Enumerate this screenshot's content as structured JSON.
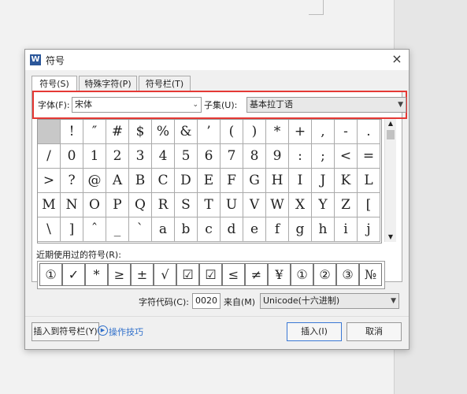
{
  "dialog": {
    "title": "符号",
    "app_icon": "W",
    "close": "×"
  },
  "tabs": [
    "符号(S)",
    "特殊字符(P)",
    "符号栏(T)"
  ],
  "font_row": {
    "font_label": "字体(F):",
    "font_value": "宋体",
    "subset_label": "子集(U):",
    "subset_value": "基本拉丁语"
  },
  "symbol_grid": [
    [
      " ",
      "!",
      "″",
      "#",
      "$",
      "%",
      "&",
      "’",
      "(",
      ")",
      "*",
      "+",
      ",",
      "-",
      ".",
      "/"
    ],
    [
      "/",
      "0",
      "1",
      "2",
      "3",
      "4",
      "5",
      "6",
      "7",
      "8",
      "9",
      ":",
      ";",
      "<",
      "="
    ],
    [
      ">",
      "?",
      "@",
      "A",
      "B",
      "C",
      "D",
      "E",
      "F",
      "G",
      "H",
      "I",
      "J",
      "K",
      "L"
    ],
    [
      "M",
      "N",
      "O",
      "P",
      "Q",
      "R",
      "S",
      "T",
      "U",
      "V",
      "W",
      "X",
      "Y",
      "Z",
      "["
    ],
    [
      "\\",
      "]",
      "ˆ",
      "_",
      "`",
      "a",
      "b",
      "c",
      "d",
      "e",
      "f",
      "g",
      "h",
      "i",
      "j"
    ]
  ],
  "recent": {
    "label": "近期使用过的符号(R):",
    "symbols": [
      "①",
      "✓",
      "*",
      "≥",
      "±",
      "√",
      "☑",
      "☑",
      "≤",
      "≠",
      "¥",
      "①",
      "②",
      "③",
      "№"
    ]
  },
  "code_row": {
    "code_label": "字符代码(C):",
    "code_value": "0020",
    "from_label": "来自(M)",
    "from_value": "Unicode(十六进制)"
  },
  "buttons": {
    "insert_to_bar": "插入到符号栏(Y)",
    "tips": "操作技巧",
    "insert": "插入(I)",
    "cancel": "取消"
  }
}
